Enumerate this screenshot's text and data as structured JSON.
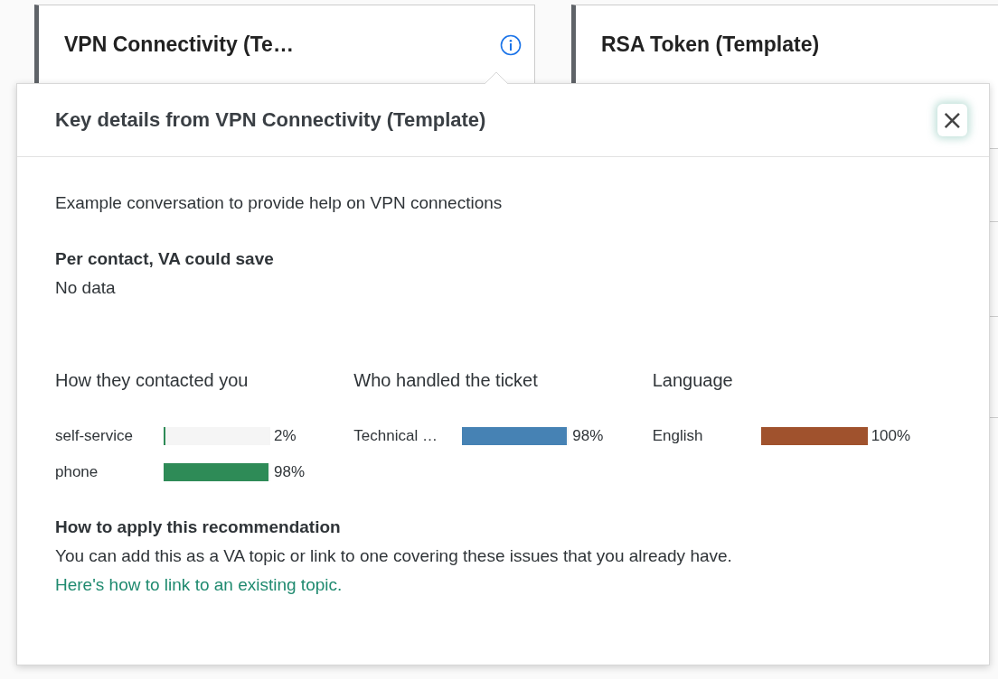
{
  "cards": [
    {
      "title": "VPN Connectivity (Te…",
      "info": true
    },
    {
      "title": "RSA Token (Template)",
      "info": false
    }
  ],
  "popover": {
    "title": "Key details from VPN Connectivity (Template)",
    "close": "×",
    "description": "Example conversation to provide help on VPN connections",
    "savings": {
      "heading": "Per contact, VA could save",
      "value": "No data"
    },
    "breakdowns": [
      {
        "heading": "How they contacted you",
        "rows": [
          {
            "label": "self-service",
            "level": 0.02,
            "reading": "2%",
            "color": "#2e8b57"
          },
          {
            "label": "phone",
            "level": 0.98,
            "reading": "98%",
            "color": "#2e8b57"
          }
        ]
      },
      {
        "heading": "Who handled the ticket",
        "rows": [
          {
            "label": "Technical …",
            "level": 0.98,
            "reading": "98%",
            "color": "#4682b4"
          }
        ]
      },
      {
        "heading": "Language",
        "rows": [
          {
            "label": "English",
            "level": 1,
            "reading": "100%",
            "color": "#a0522d"
          }
        ]
      }
    ],
    "apply": {
      "heading": "How to apply this recommendation",
      "text": "You can add this as a VA topic or link to one covering these issues that you already have.",
      "link": "Here's how to link to an existing topic."
    }
  }
}
